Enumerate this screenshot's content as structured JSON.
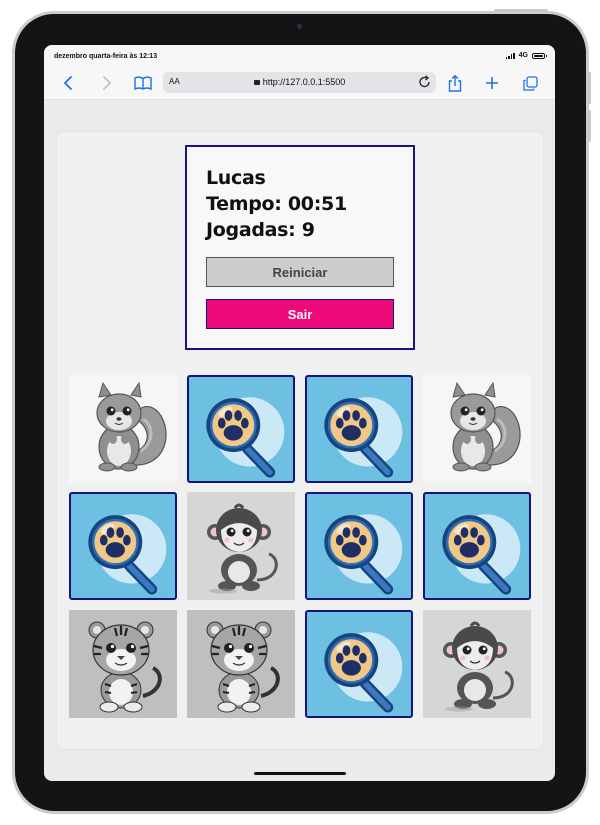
{
  "status_bar": {
    "time": "dezembro quarta-feira às 12:13",
    "network": "4G"
  },
  "browser": {
    "text_size_label": "AA",
    "url": "http://127.0.0.1:5500",
    "icons": [
      "back-icon",
      "forward-icon",
      "reader-book-icon",
      "lock-icon",
      "reload-icon",
      "share-icon",
      "new-tab-icon",
      "tabs-icon"
    ]
  },
  "game": {
    "player": "Lucas",
    "time_label": "Tempo: 00:51",
    "moves_label": "Jogadas: 9",
    "restart_label": "Reiniciar",
    "exit_label": "Sair",
    "colors": {
      "panel_border": "#14147a",
      "card_back": "#6ec0e3",
      "exit_button": "#ee0a78",
      "restart_button": "#cdcdcd"
    },
    "cards": [
      {
        "state": "revealed",
        "animal": "squirrel"
      },
      {
        "state": "hidden",
        "animal": "paw-magnifier"
      },
      {
        "state": "hidden",
        "animal": "paw-magnifier"
      },
      {
        "state": "revealed",
        "animal": "squirrel"
      },
      {
        "state": "hidden",
        "animal": "paw-magnifier"
      },
      {
        "state": "revealed",
        "animal": "monkey"
      },
      {
        "state": "hidden",
        "animal": "paw-magnifier"
      },
      {
        "state": "hidden",
        "animal": "paw-magnifier"
      },
      {
        "state": "revealed",
        "animal": "tiger"
      },
      {
        "state": "revealed",
        "animal": "tiger"
      },
      {
        "state": "hidden",
        "animal": "paw-magnifier"
      },
      {
        "state": "revealed",
        "animal": "monkey"
      }
    ]
  }
}
